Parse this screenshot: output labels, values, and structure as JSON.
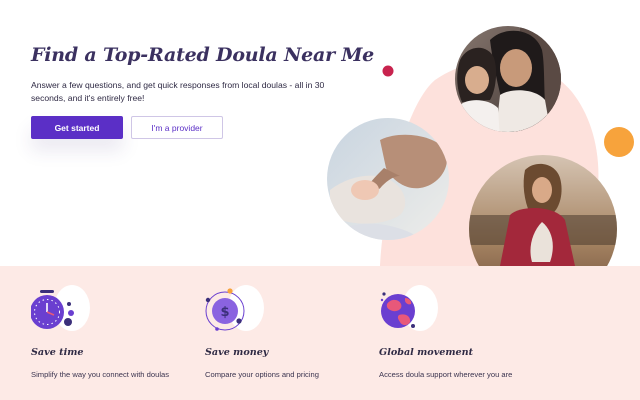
{
  "hero": {
    "title": "Find a Top-Rated Doula Near Me",
    "subtitle": "Answer a few questions, and get quick responses from local doulas - all in 30 seconds, and it's entirely free!",
    "primary_button": "Get started",
    "secondary_button": "I'm a provider"
  },
  "colors": {
    "brand_purple": "#5b2fc6",
    "heading": "#3b3160",
    "blush": "#fdeae6",
    "accent_orange": "#f7a33c",
    "accent_red": "#c8234e"
  },
  "features": [
    {
      "icon": "stopwatch-icon",
      "title": "Save time",
      "description": "Simplify the way you connect with doulas"
    },
    {
      "icon": "dollar-coin-icon",
      "title": "Save money",
      "description": "Compare your options and pricing"
    },
    {
      "icon": "globe-icon",
      "title": "Global movement",
      "description": "Access doula support wherever you are"
    }
  ]
}
